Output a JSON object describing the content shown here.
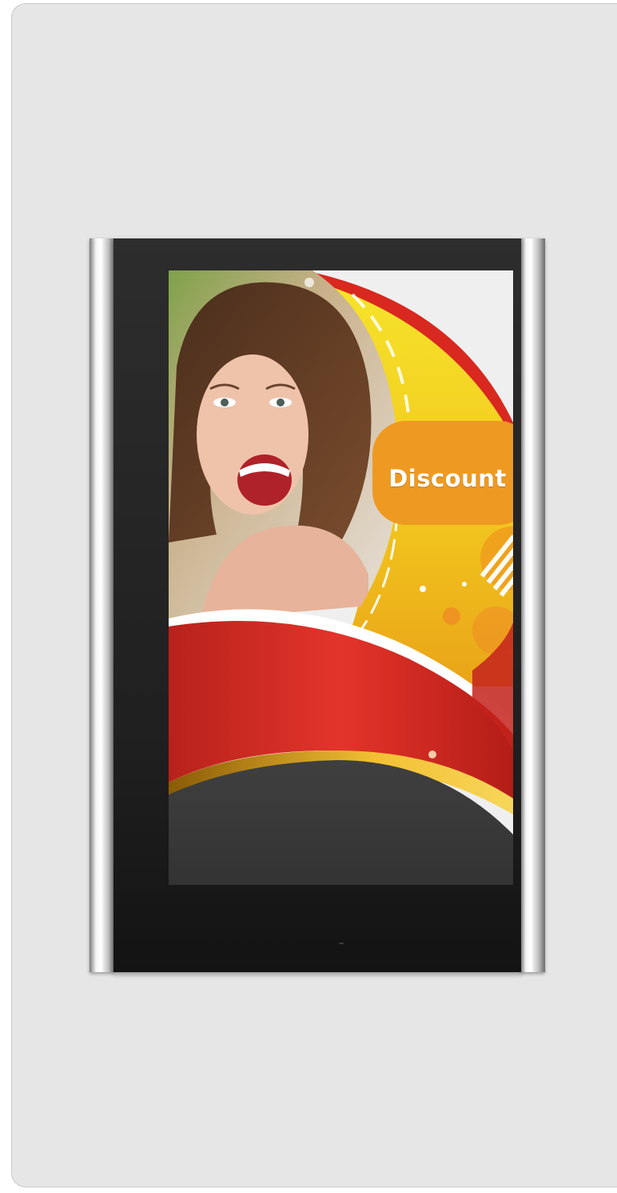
{
  "promo": {
    "badge_label": "Discount"
  },
  "colors": {
    "page_background": "#e6e6e6",
    "bezel": "#222222",
    "red_band": "#d9281f",
    "yellow_arc": "#f3d21f",
    "orange_badge": "#ee9a22",
    "dark_base": "#3a3a3a"
  },
  "icons": {
    "sensor": "sensor-dot-icon"
  }
}
